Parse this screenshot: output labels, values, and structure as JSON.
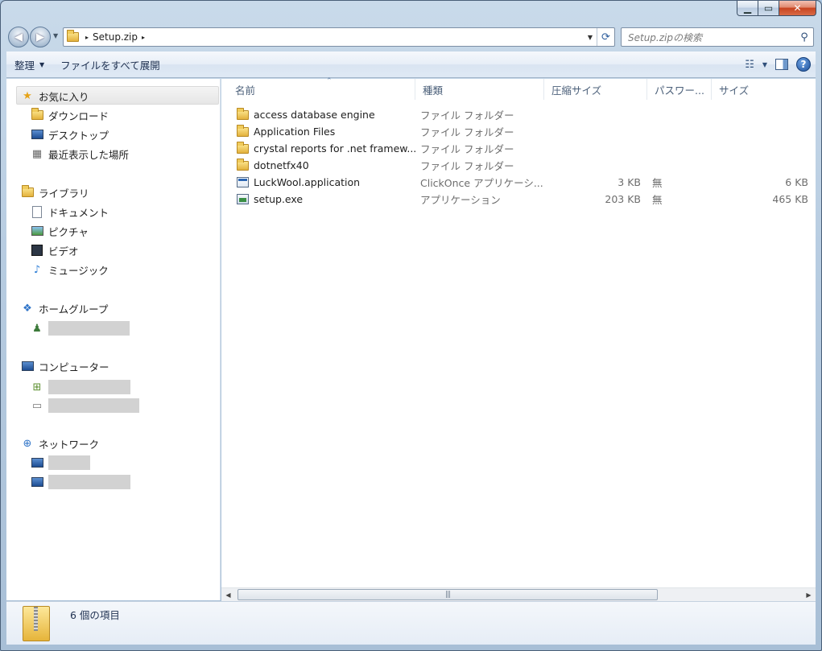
{
  "window": {
    "caption_min": "▁",
    "caption_max": "▭",
    "caption_close": "✕"
  },
  "nav": {
    "back_glyph": "◀",
    "forward_glyph": "▶"
  },
  "address": {
    "path": [
      "Setup.zip"
    ],
    "separator": "▸"
  },
  "search": {
    "placeholder": "Setup.zipの検索"
  },
  "toolbar": {
    "organize": "整理",
    "extract_all": "ファイルをすべて展開"
  },
  "sidebar": {
    "favorites": {
      "label": "お気に入り",
      "items": [
        {
          "label": "ダウンロード",
          "icon": "download-folder-icon"
        },
        {
          "label": "デスクトップ",
          "icon": "desktop-icon"
        },
        {
          "label": "最近表示した場所",
          "icon": "recent-places-icon"
        }
      ]
    },
    "libraries": {
      "label": "ライブラリ",
      "items": [
        {
          "label": "ドキュメント",
          "icon": "documents-icon"
        },
        {
          "label": "ピクチャ",
          "icon": "pictures-icon"
        },
        {
          "label": "ビデオ",
          "icon": "videos-icon"
        },
        {
          "label": "ミュージック",
          "icon": "music-icon"
        }
      ]
    },
    "homegroup": {
      "label": "ホームグループ"
    },
    "computer": {
      "label": "コンピューター"
    },
    "network": {
      "label": "ネットワーク"
    }
  },
  "columns": [
    "名前",
    "種類",
    "圧縮サイズ",
    "パスワー...",
    "サイズ"
  ],
  "files": [
    {
      "name": "access database engine",
      "type": "ファイル フォルダー",
      "compressed": "",
      "password": "",
      "size": "",
      "icon": "folder-icon"
    },
    {
      "name": "Application Files",
      "type": "ファイル フォルダー",
      "compressed": "",
      "password": "",
      "size": "",
      "icon": "folder-icon"
    },
    {
      "name": "crystal reports for .net framew...",
      "type": "ファイル フォルダー",
      "compressed": "",
      "password": "",
      "size": "",
      "icon": "folder-icon"
    },
    {
      "name": "dotnetfx40",
      "type": "ファイル フォルダー",
      "compressed": "",
      "password": "",
      "size": "",
      "icon": "folder-icon"
    },
    {
      "name": "LuckWool.application",
      "type": "ClickOnce アプリケーシ...",
      "compressed": "3 KB",
      "password": "無",
      "size": "6 KB",
      "icon": "clickonce-app-icon"
    },
    {
      "name": "setup.exe",
      "type": "アプリケーション",
      "compressed": "203 KB",
      "password": "無",
      "size": "465 KB",
      "icon": "exe-icon"
    }
  ],
  "status": {
    "item_count": "6 個の項目"
  }
}
